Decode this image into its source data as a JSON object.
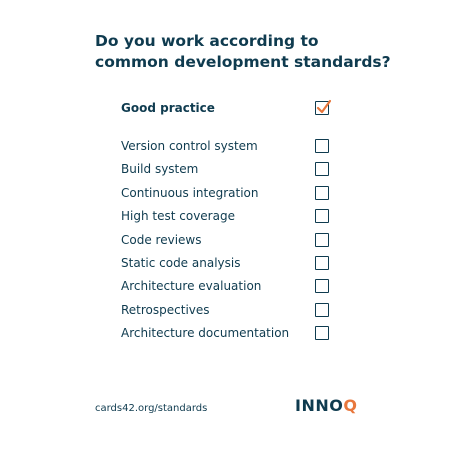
{
  "title": {
    "line1": "Do you work according to",
    "line2": "common development standards?"
  },
  "checklist": {
    "header": {
      "label": "Good practice",
      "checked": true
    },
    "items": [
      {
        "label": "Version control system",
        "checked": false
      },
      {
        "label": "Build system",
        "checked": false
      },
      {
        "label": "Continuous integration",
        "checked": false
      },
      {
        "label": "High test coverage",
        "checked": false
      },
      {
        "label": "Code reviews",
        "checked": false
      },
      {
        "label": "Static code analysis",
        "checked": false
      },
      {
        "label": "Architecture evaluation",
        "checked": false
      },
      {
        "label": "Retrospectives",
        "checked": false
      },
      {
        "label": "Architecture documentation",
        "checked": false
      }
    ]
  },
  "footer": {
    "link": "cards42.org/standards",
    "logo_main": "INNO",
    "logo_accent": "Q"
  },
  "colors": {
    "text": "#0f3b4f",
    "accent": "#e8773c",
    "background": "#ffffff"
  }
}
